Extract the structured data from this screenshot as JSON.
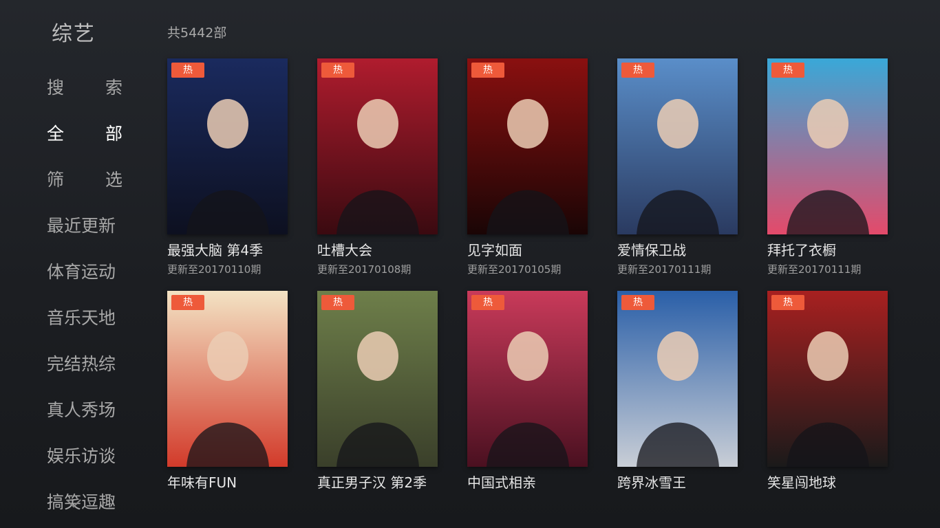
{
  "header": {
    "category": "综艺",
    "total": "共5442部"
  },
  "sidebar": {
    "items": [
      {
        "label": "搜索",
        "chars": [
          "搜",
          "索"
        ],
        "spread": true,
        "active": false
      },
      {
        "label": "全部",
        "chars": [
          "全",
          "部"
        ],
        "spread": true,
        "active": true
      },
      {
        "label": "筛选",
        "chars": [
          "筛",
          "选"
        ],
        "spread": true,
        "active": false
      },
      {
        "label": "最近更新",
        "spread": false,
        "active": false
      },
      {
        "label": "体育运动",
        "spread": false,
        "active": false
      },
      {
        "label": "音乐天地",
        "spread": false,
        "active": false
      },
      {
        "label": "完结热综",
        "spread": false,
        "active": false
      },
      {
        "label": "真人秀场",
        "spread": false,
        "active": false
      },
      {
        "label": "娱乐访谈",
        "spread": false,
        "active": false
      },
      {
        "label": "搞笑逗趣",
        "spread": false,
        "active": false
      }
    ],
    "more_icon": "chevron-down-icon"
  },
  "shows": [
    {
      "title": "最强大脑 第4季",
      "update": "更新至20170110期",
      "badge": "热",
      "colors": [
        "#1a2a5e",
        "#0d1020"
      ]
    },
    {
      "title": "吐槽大会",
      "update": "更新至20170108期",
      "badge": "热",
      "colors": [
        "#b01c2e",
        "#3a0a10"
      ]
    },
    {
      "title": "见字如面",
      "update": "更新至20170105期",
      "badge": "热",
      "colors": [
        "#8a1010",
        "#1a0505"
      ]
    },
    {
      "title": "爱情保卫战",
      "update": "更新至20170111期",
      "badge": "热",
      "colors": [
        "#5a8ec9",
        "#2a3a60"
      ]
    },
    {
      "title": "拜托了衣橱",
      "update": "更新至20170111期",
      "badge": "热",
      "colors": [
        "#39a8d8",
        "#e44a6a"
      ]
    },
    {
      "title": "年味有FUN",
      "update": "",
      "badge": "热",
      "colors": [
        "#f3e3c4",
        "#d23a2a"
      ]
    },
    {
      "title": "真正男子汉 第2季",
      "update": "",
      "badge": "热",
      "colors": [
        "#6e7f4a",
        "#3a3f2a"
      ]
    },
    {
      "title": "中国式相亲",
      "update": "",
      "badge": "热",
      "colors": [
        "#c93a5a",
        "#4a1020"
      ]
    },
    {
      "title": "跨界冰雪王",
      "update": "",
      "badge": "热",
      "colors": [
        "#2a5fa8",
        "#c9ced6"
      ]
    },
    {
      "title": "笑星闯地球",
      "update": "",
      "badge": "热",
      "colors": [
        "#a82020",
        "#1a1a1a"
      ]
    }
  ]
}
